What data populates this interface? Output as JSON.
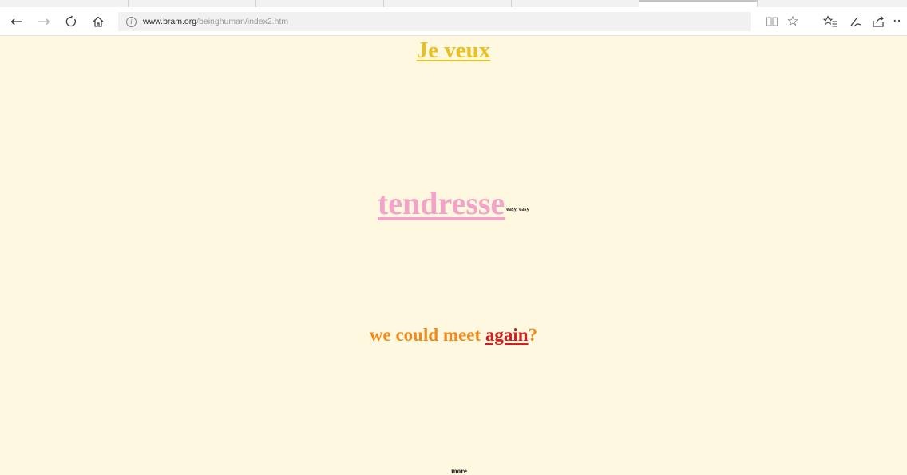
{
  "browser": {
    "url_host": "www.bram.org",
    "url_path": "/beinghuman/index2.htm"
  },
  "page": {
    "je_veux": "Je veux",
    "tendresse": "tendresse",
    "easy": "easy, easy",
    "we_could_meet": "we could meet ",
    "again": "again",
    "question_mark": "?",
    "more": "more"
  },
  "colors": {
    "background": "#fff8e0",
    "je_veux": "#e8c020",
    "tendresse": "#f2a3c7",
    "meet_text": "#ef8a1b",
    "again_link": "#d02020"
  }
}
